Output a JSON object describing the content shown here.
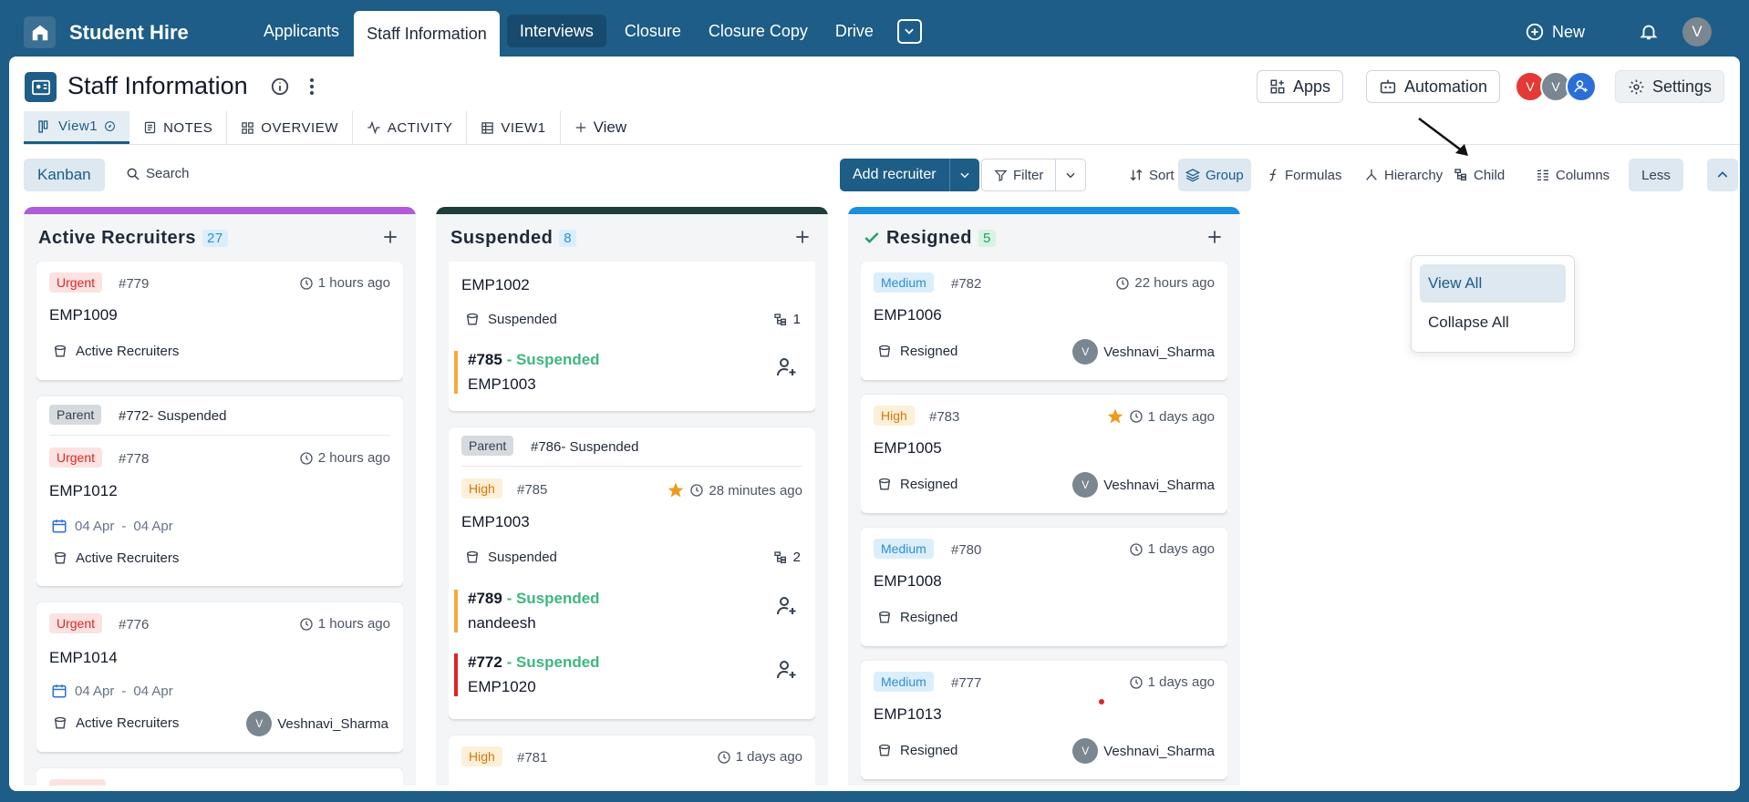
{
  "app": {
    "name": "Student Hire"
  },
  "nav": {
    "tabs": [
      "Applicants",
      "Staff Information",
      "Interviews",
      "Closure",
      "Closure Copy",
      "Drive"
    ],
    "new_label": "New",
    "user_initial": "V"
  },
  "page": {
    "title": "Staff Information"
  },
  "header_buttons": {
    "apps": "Apps",
    "automation": "Automation",
    "settings": "Settings"
  },
  "member_avatars": [
    "V",
    "V"
  ],
  "view_tabs": [
    "View1",
    "NOTES",
    "OVERVIEW",
    "ACTIVITY",
    "VIEW1",
    "View"
  ],
  "toolbar": {
    "kanban": "Kanban",
    "search": "Search",
    "add": "Add recruiter",
    "filter": "Filter",
    "sort": "Sort",
    "group": "Group",
    "formulas": "Formulas",
    "hierarchy": "Hierarchy",
    "child": "Child",
    "columns": "Columns",
    "less": "Less"
  },
  "dropdown": {
    "items": [
      "View All",
      "Collapse All"
    ]
  },
  "colors": {
    "brand": "#1d5d87",
    "active_col": "#b05bd8",
    "suspended_col": "#1f3d3a",
    "resigned_col": "#1a8fe0"
  },
  "columns": [
    {
      "name": "Active Recruiters",
      "count": "27",
      "cards": [
        {
          "priority": "Urgent",
          "id": "#779",
          "time": "1 hours ago",
          "emp": "EMP1009",
          "status": "Active Recruiters"
        },
        {
          "parent": "Parent",
          "parent_ref": "#772- Suspended",
          "priority": "Urgent",
          "id": "#778",
          "time": "2 hours ago",
          "emp": "EMP1012",
          "date_from": "04 Apr",
          "date_sep": "-",
          "date_to": "04 Apr",
          "status": "Active Recruiters"
        },
        {
          "priority": "Urgent",
          "id": "#776",
          "time": "1 hours ago",
          "emp": "EMP1014",
          "date_from": "04 Apr",
          "date_sep": "-",
          "date_to": "04 Apr",
          "status": "Active Recruiters",
          "assignee": "Veshnavi_Sharma",
          "assignee_initial": "V"
        }
      ]
    },
    {
      "name": "Suspended",
      "count": "8",
      "cards": [
        {
          "emp": "EMP1002",
          "status": "Suspended",
          "subtasks": "1",
          "child_id": "#785",
          "child_status": "- Suspended",
          "child_emp": "EMP1003"
        },
        {
          "parent": "Parent",
          "parent_ref": "#786- Suspended",
          "priority": "High",
          "id": "#785",
          "time": "28 minutes ago",
          "emp": "EMP1003",
          "status": "Suspended",
          "subtasks": "2",
          "children": [
            {
              "id": "#789",
              "status": "- Suspended",
              "emp": "nandeesh"
            },
            {
              "id": "#772",
              "status": "- Suspended",
              "emp": "EMP1020"
            }
          ]
        },
        {
          "priority": "High",
          "id": "#781",
          "time": "1 days ago"
        }
      ]
    },
    {
      "name": "Resigned",
      "count": "5",
      "cards": [
        {
          "priority": "Medium",
          "id": "#782",
          "time": "22 hours ago",
          "emp": "EMP1006",
          "status": "Resigned",
          "assignee": "Veshnavi_Sharma",
          "assignee_initial": "V"
        },
        {
          "priority": "High",
          "id": "#783",
          "time": "1 days ago",
          "emp": "EMP1005",
          "status": "Resigned",
          "assignee": "Veshnavi_Sharma",
          "assignee_initial": "V"
        },
        {
          "priority": "Medium",
          "id": "#780",
          "time": "1 days ago",
          "emp": "EMP1008",
          "status": "Resigned"
        },
        {
          "priority": "Medium",
          "id": "#777",
          "time": "1 days ago",
          "emp": "EMP1013",
          "status": "Resigned",
          "assignee": "Veshnavi_Sharma",
          "assignee_initial": "V"
        }
      ]
    }
  ]
}
